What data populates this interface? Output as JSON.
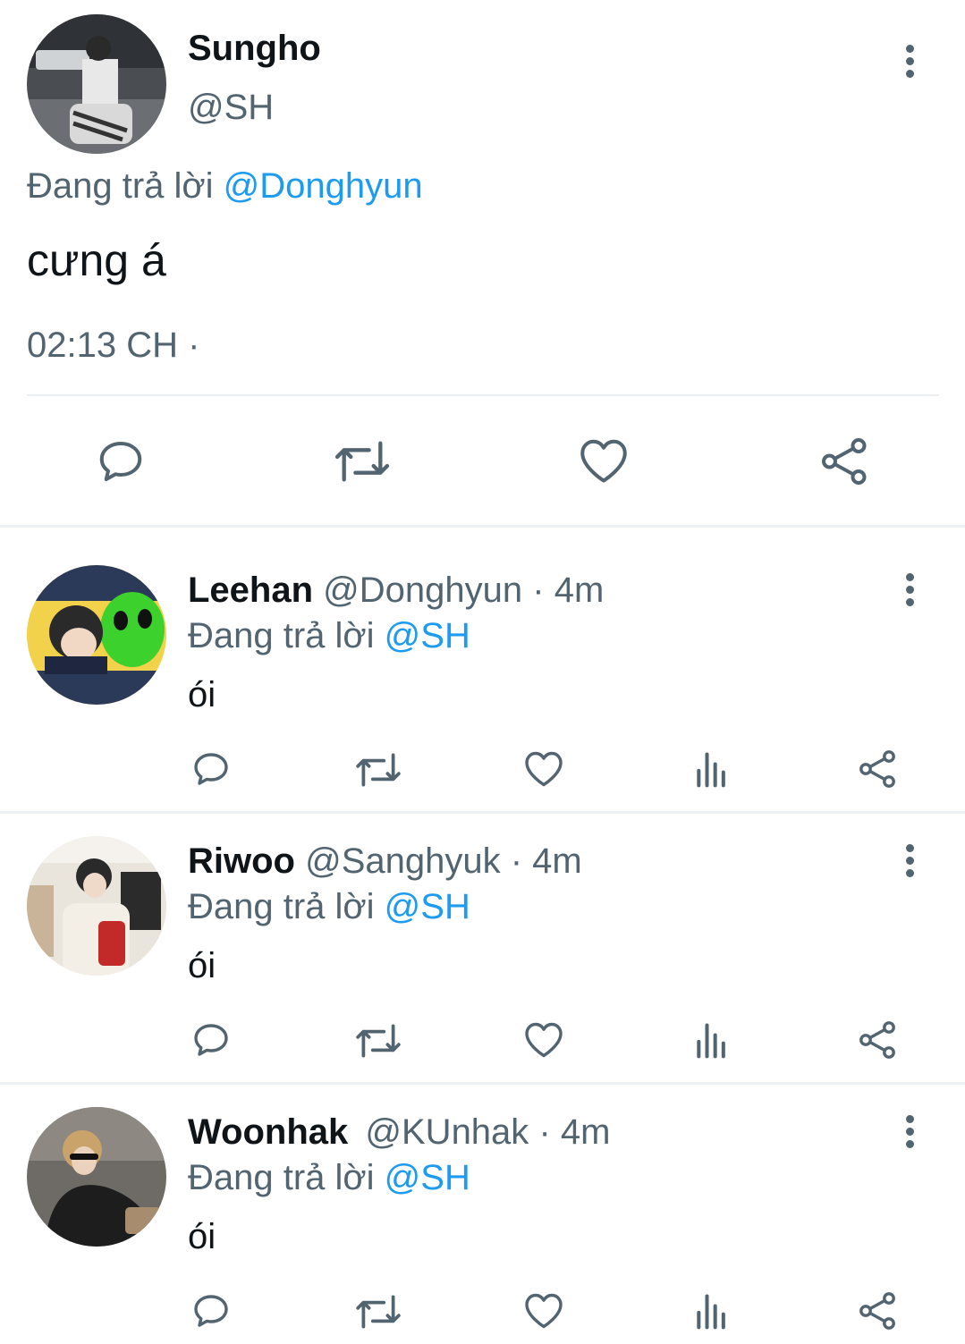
{
  "main_tweet": {
    "name": "Sungho",
    "handle": "@SH",
    "reply_prefix": "Đang trả lời",
    "reply_to": "@Donghyun",
    "text": "cưng á",
    "time": "02:13 CH ·"
  },
  "replies": [
    {
      "name": "Leehan",
      "handle": "@Donghyun",
      "age": "· 4m",
      "reply_prefix": "Đang trả lời",
      "reply_to": "@SH",
      "text": "ói"
    },
    {
      "name": "Riwoo",
      "handle": "@Sanghyuk",
      "age": "· 4m",
      "reply_prefix": "Đang trả lời",
      "reply_to": "@SH",
      "text": "ói"
    },
    {
      "name": "Woonhak",
      "handle": "@KUnhak",
      "age": "· 4m",
      "reply_prefix": "Đang trả lời",
      "reply_to": "@SH",
      "text": "ói"
    }
  ],
  "icons": {
    "reply": "speech-bubble-icon",
    "retweet": "retweet-icon",
    "like": "heart-icon",
    "views": "bar-chart-icon",
    "share": "share-icon",
    "more": "more-vertical-icon"
  },
  "colors": {
    "accent": "#1d9bf0",
    "muted": "#536471",
    "text": "#0f1419"
  }
}
